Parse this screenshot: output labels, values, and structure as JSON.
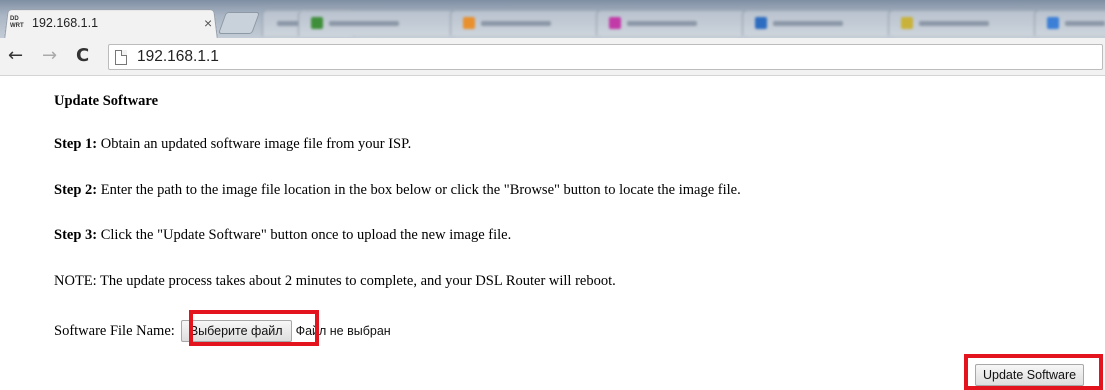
{
  "browser": {
    "active_tab": {
      "favicon_text": [
        "DD",
        "WRT"
      ],
      "title": "192.168.1.1",
      "close_glyph": "×"
    },
    "background_tab_colors": [
      "#3f8f3a",
      "#e8902e",
      "#c23aa8",
      "#2d6cc0",
      "#c9b23a",
      "#3b7fd6"
    ],
    "nav": {
      "back_glyph": "←",
      "forward_glyph": "→",
      "reload_glyph": "C"
    },
    "address": "192.168.1.1"
  },
  "page": {
    "heading": "Update Software",
    "steps": [
      {
        "label": "Step 1:",
        "text": " Obtain an updated software image file from your ISP."
      },
      {
        "label": "Step 2:",
        "text": " Enter the path to the image file location in the box below or click the \"Browse\" button to locate the image file."
      },
      {
        "label": "Step 3:",
        "text": " Click the \"Update Software\" button once to upload the new image file."
      }
    ],
    "note": "NOTE: The update process takes about 2 minutes to complete, and your DSL Router will reboot.",
    "file_label": "Software File Name:",
    "file_button": "Выберите файл",
    "file_status": "Файл не выбран",
    "submit_button": "Update Software"
  },
  "colors": {
    "highlight": "#e3141d"
  }
}
